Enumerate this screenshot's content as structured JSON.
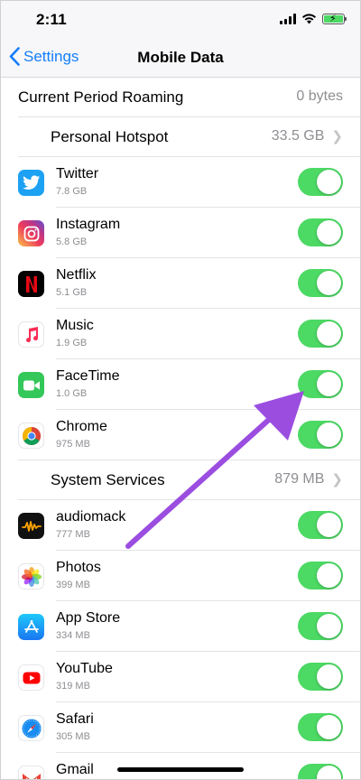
{
  "status_bar": {
    "time": "2:11"
  },
  "nav": {
    "back_label": "Settings",
    "title": "Mobile Data"
  },
  "colors": {
    "accent": "#157efb",
    "toggle_on": "#4cd964",
    "annotation_arrow": "#9b4de0"
  },
  "summary_rows": [
    {
      "label": "Current Period Roaming",
      "value": "0 bytes"
    },
    {
      "label": "Personal Hotspot",
      "value": "33.5 GB"
    }
  ],
  "apps_group1": [
    {
      "name": "Twitter",
      "size": "7.8 GB",
      "icon": "twitter-icon",
      "enabled": true
    },
    {
      "name": "Instagram",
      "size": "5.8 GB",
      "icon": "instagram-icon",
      "enabled": true
    },
    {
      "name": "Netflix",
      "size": "5.1 GB",
      "icon": "netflix-icon",
      "enabled": true
    },
    {
      "name": "Music",
      "size": "1.9 GB",
      "icon": "music-icon",
      "enabled": true
    },
    {
      "name": "FaceTime",
      "size": "1.0 GB",
      "icon": "facetime-icon",
      "enabled": true
    },
    {
      "name": "Chrome",
      "size": "975 MB",
      "icon": "chrome-icon",
      "enabled": true
    }
  ],
  "system_services": {
    "label": "System Services",
    "value": "879 MB"
  },
  "apps_group2": [
    {
      "name": "audiomack",
      "size": "777 MB",
      "icon": "audiomack-icon",
      "enabled": true
    },
    {
      "name": "Photos",
      "size": "399 MB",
      "icon": "photos-icon",
      "enabled": true
    },
    {
      "name": "App Store",
      "size": "334 MB",
      "icon": "app-store-icon",
      "enabled": true
    },
    {
      "name": "YouTube",
      "size": "319 MB",
      "icon": "youtube-icon",
      "enabled": true
    },
    {
      "name": "Safari",
      "size": "305 MB",
      "icon": "safari-icon",
      "enabled": true
    },
    {
      "name": "Gmail",
      "size": "",
      "icon": "gmail-icon",
      "enabled": true
    }
  ]
}
